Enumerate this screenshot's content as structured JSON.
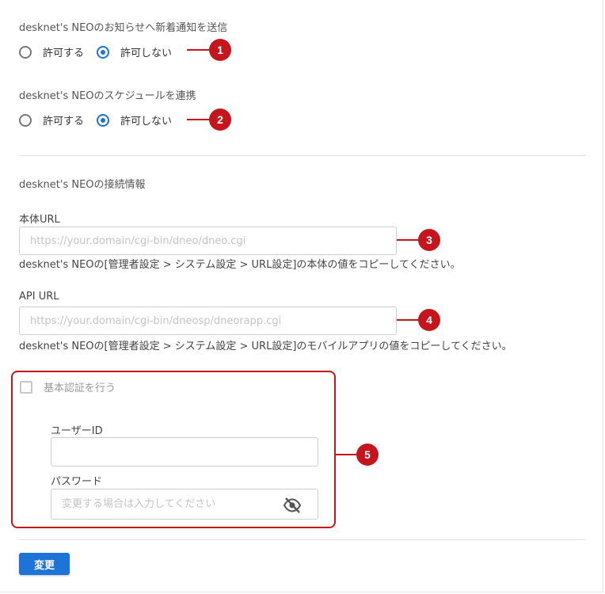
{
  "notification": {
    "label": "desknet's NEOのお知らせへ新着通知を送信",
    "options": [
      "許可する",
      "許可しない"
    ],
    "selected": "許可しない"
  },
  "schedule": {
    "label": "desknet's NEOのスケジュールを連携",
    "options": [
      "許可する",
      "許可しない"
    ],
    "selected": "許可しない"
  },
  "connection": {
    "heading": "desknet's NEOの接続情報",
    "main_url": {
      "label": "本体URL",
      "placeholder": "https://your.domain/cgi-bin/dneo/dneo.cgi",
      "help": "desknet's NEOの[管理者設定 > システム設定 > URL設定]の本体の値をコピーしてください。"
    },
    "api_url": {
      "label": "API URL",
      "placeholder": "https://your.domain/cgi-bin/dneosp/dneorapp.cgi",
      "help": "desknet's NEOの[管理者設定 > システム設定 > URL設定]のモバイルアプリの値をコピーしてください。"
    }
  },
  "basic_auth": {
    "checkbox_label": "基本認証を行う",
    "user_id_label": "ユーザーID",
    "user_id_value": "",
    "password_label": "パスワード",
    "password_placeholder": "変更する場合は入力してください",
    "eye_icon": "eye-off-icon"
  },
  "callouts": [
    "1",
    "2",
    "3",
    "4",
    "5"
  ],
  "submit_label": "変更",
  "colors": {
    "accent": "#1e73d6",
    "callout": "#c4161c"
  }
}
